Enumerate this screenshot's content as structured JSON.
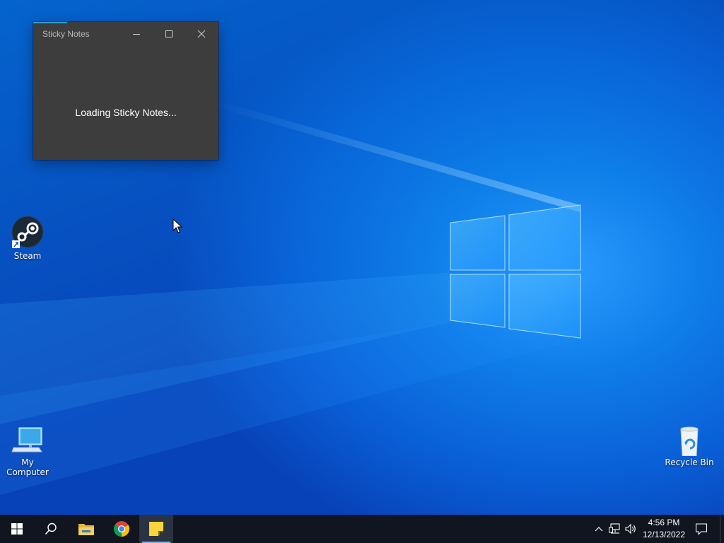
{
  "desktop": {
    "icons": [
      {
        "label": "Steam",
        "icon": "steam-icon"
      },
      {
        "label": "My Computer",
        "icon": "computer-icon"
      },
      {
        "label": "Recycle Bin",
        "icon": "recycle-bin-icon"
      }
    ]
  },
  "sticky_window": {
    "title": "Sticky Notes",
    "loading_text": "Loading Sticky Notes...",
    "buttons": [
      "minimize-icon",
      "maximize-icon",
      "close-icon"
    ]
  },
  "taskbar": {
    "apps": [
      {
        "name": "start",
        "icon": "windows-start-icon",
        "active": false
      },
      {
        "name": "search",
        "icon": "search-icon",
        "active": false
      },
      {
        "name": "file-explorer",
        "icon": "folder-icon",
        "active": false
      },
      {
        "name": "chrome",
        "icon": "chrome-icon",
        "active": false
      },
      {
        "name": "sticky-notes",
        "icon": "sticky-notes-icon",
        "active": true
      }
    ],
    "tray": {
      "icons": [
        "chevron-up-icon",
        "network-icon",
        "volume-icon"
      ],
      "time": "4:56 PM",
      "date": "12/13/2022",
      "notification_icon": "notification-icon"
    }
  },
  "colors": {
    "accent_blue": "#0a74da",
    "taskbar_bg": "#10151f",
    "window_bg": "#3d3d3d",
    "sticky_yellow": "#f9d43a"
  }
}
